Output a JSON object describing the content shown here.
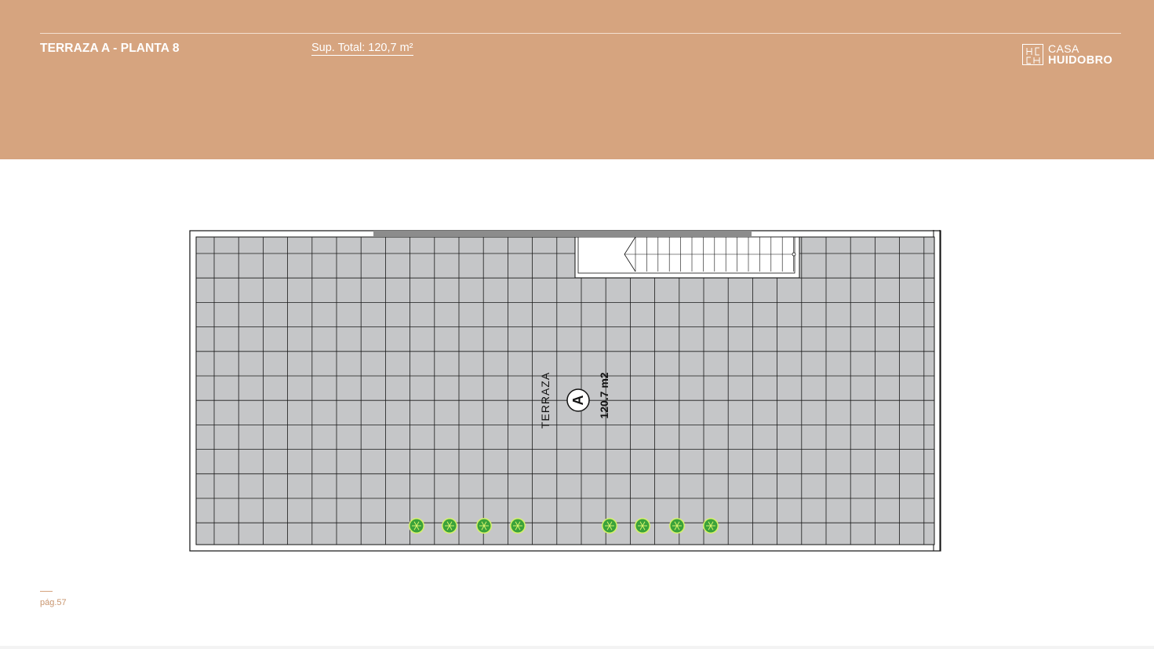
{
  "header": {
    "title": "TERRAZA A - PLANTA 8",
    "surface": "Sup. Total: 120,7 m²",
    "logo": {
      "monogram": "HCH",
      "line1": "CASA",
      "line2": "HUIDOBRO"
    }
  },
  "plan": {
    "room_label": "TERRAZA",
    "unit_marker": "A",
    "area_label": "120.7 m2",
    "colors": {
      "floor": "#c5c6c8",
      "grid": "#1a1a1a",
      "plant": "#3aa23a",
      "plant_center": "#d7f26b"
    },
    "plant_count": 8
  },
  "footer": {
    "page": "pág.57"
  }
}
